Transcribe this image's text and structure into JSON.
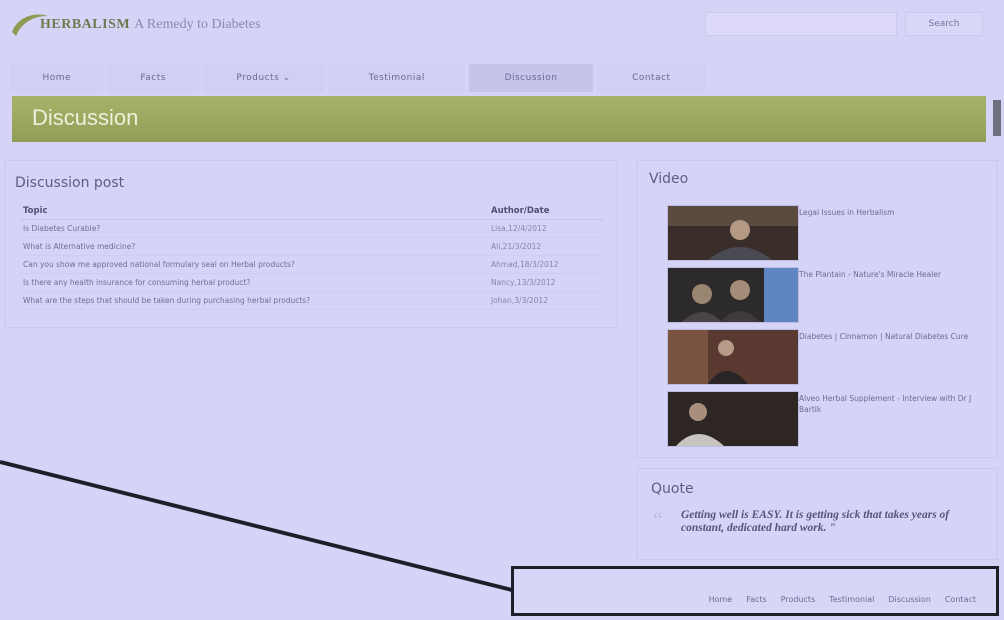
{
  "header": {
    "logo_brand": "HERBALISM",
    "logo_tagline": "A Remedy to Diabetes",
    "search_placeholder": "",
    "search_button": "Search"
  },
  "nav": {
    "items": [
      {
        "label": "Home"
      },
      {
        "label": "Facts"
      },
      {
        "label": "Products ⌄"
      },
      {
        "label": "Testimonial"
      },
      {
        "label": "Discussion"
      },
      {
        "label": "Contact"
      }
    ]
  },
  "banner": {
    "title": "Discussion"
  },
  "discussion": {
    "title": "Discussion post",
    "columns": {
      "topic": "Topic",
      "author": "Author/Date"
    },
    "rows": [
      {
        "topic": "Is Diabetes Curable?",
        "author": "Lisa,12/4/2012"
      },
      {
        "topic": "What is Alternative medicine?",
        "author": "Ali,21/3/2012"
      },
      {
        "topic": "Can you show me approved national formulary seal on Herbal products?",
        "author": "Ahmad,18/3/2012"
      },
      {
        "topic": "Is there any health insurance for consuming herbal product?",
        "author": "Nancy,13/3/2012"
      },
      {
        "topic": "What are the steps that should be taken during purchasing herbal products?",
        "author": "Johan,3/3/2012"
      }
    ]
  },
  "video": {
    "title": "Video",
    "items": [
      {
        "label": "Legal Issues in Herbalism"
      },
      {
        "label": "The Plantain - Nature's Miracle Healer"
      },
      {
        "label": "Diabetes | Cinnamon | Natural Diabetes Cure"
      },
      {
        "label": "Alveo Herbal Supplement - Interview with Dr J Bartik"
      }
    ]
  },
  "quote": {
    "title": "Quote",
    "text": "Getting well is EASY. It is getting sick that takes years of constant, dedicated hard work. \""
  },
  "footer": {
    "links": [
      {
        "label": "Home"
      },
      {
        "label": "Facts"
      },
      {
        "label": "Products"
      },
      {
        "label": "Testimonial"
      },
      {
        "label": "Discussion"
      },
      {
        "label": "Contact"
      }
    ]
  }
}
